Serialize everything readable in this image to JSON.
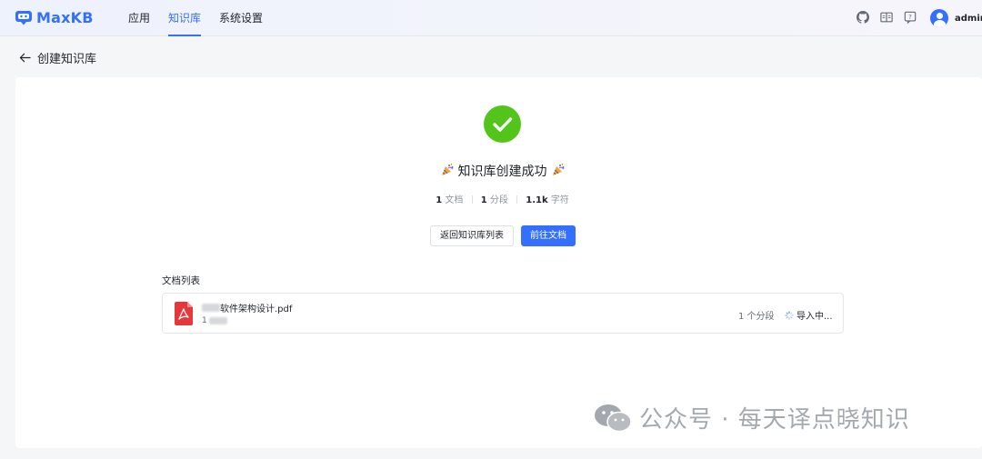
{
  "header": {
    "logo_text": "MaxKB",
    "nav": [
      {
        "label": "应用",
        "active": false
      },
      {
        "label": "知识库",
        "active": true
      },
      {
        "label": "系统设置",
        "active": false
      }
    ],
    "icons": [
      "github-icon",
      "book-icon",
      "help-icon"
    ],
    "username": "admin"
  },
  "page": {
    "title": "创建知识库"
  },
  "result": {
    "title": "知识库创建成功",
    "stats": [
      {
        "value": "1",
        "unit": "文档"
      },
      {
        "value": "1",
        "unit": "分段"
      },
      {
        "value": "1.1k",
        "unit": "字符"
      }
    ],
    "back_button": "返回知识库列表",
    "go_button": "前往文档"
  },
  "documents": {
    "label": "文档列表",
    "items": [
      {
        "name_visible": "软件架构设计.pdf",
        "sub_visible": "1",
        "paragraphs": "1 个分段",
        "status": "导入中..."
      }
    ]
  },
  "watermark": {
    "text": "公众号 · 每天译点晓知识"
  },
  "colors": {
    "accent": "#3370ff",
    "success": "#52c41a",
    "pdf": "#e5383b"
  }
}
